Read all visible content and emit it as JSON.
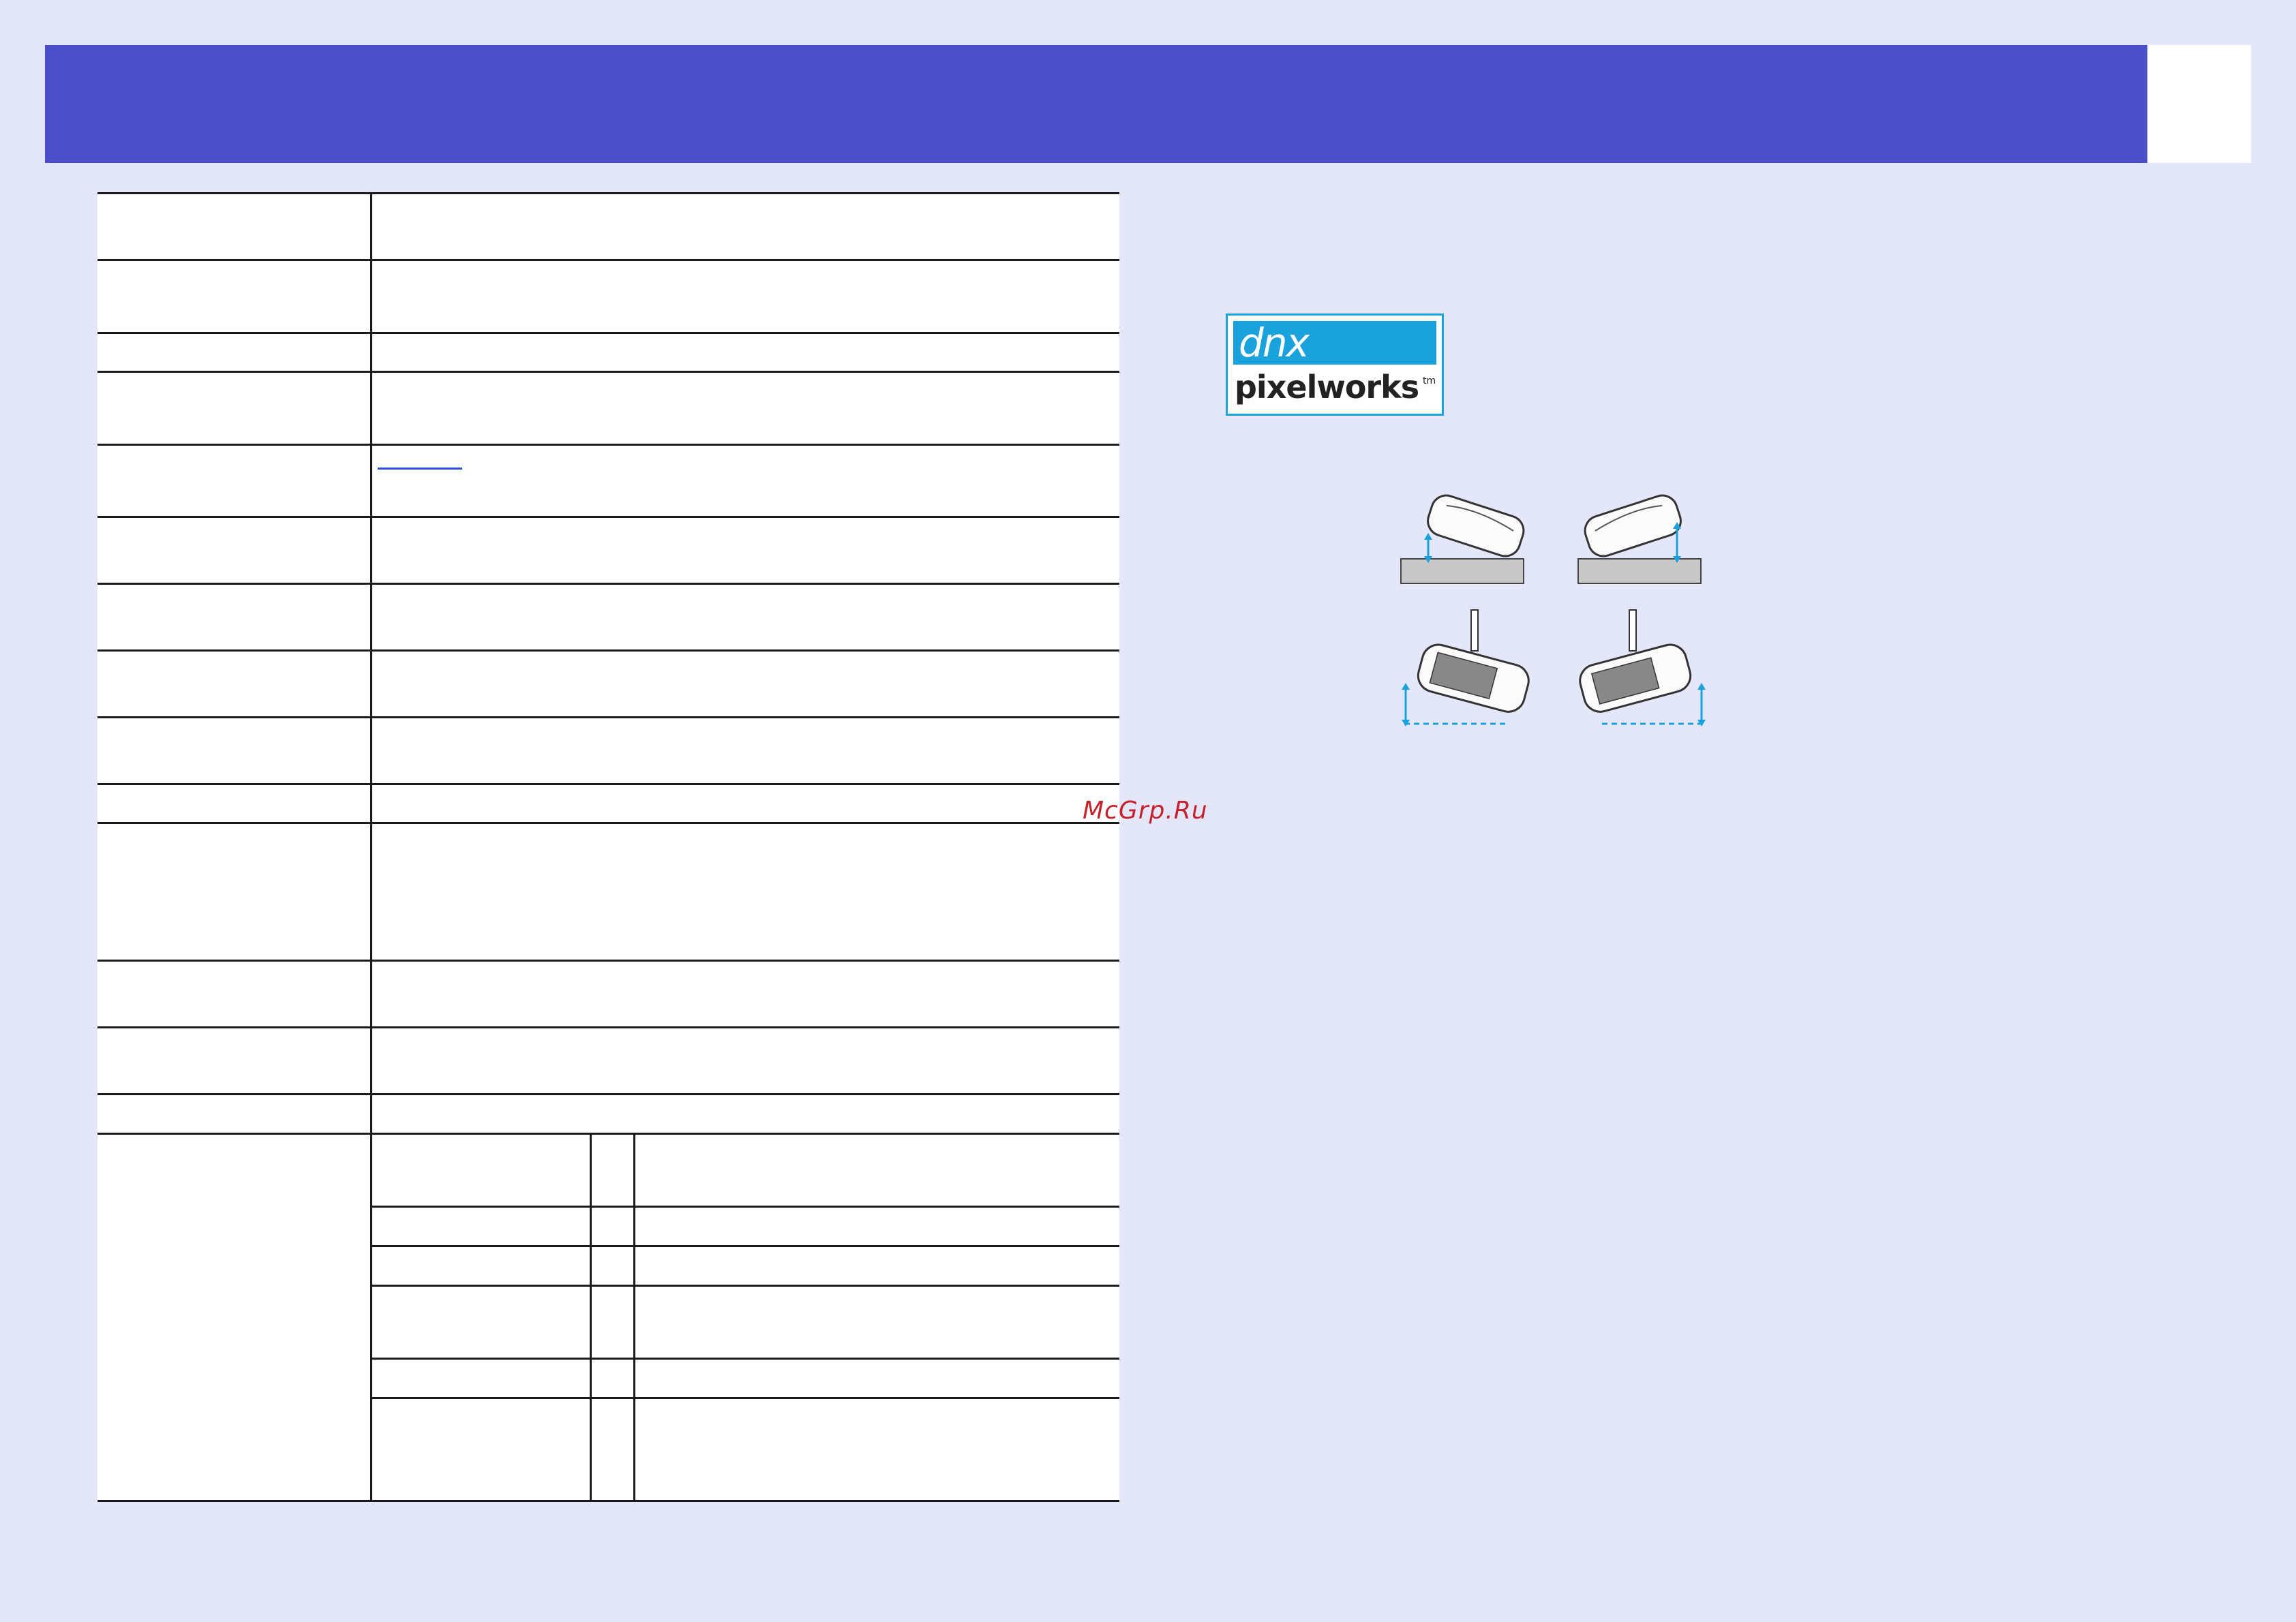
{
  "header": {
    "title": "",
    "page_number": ""
  },
  "spec_table": {
    "rows": [
      {
        "label": "",
        "value": ""
      },
      {
        "label": "",
        "value": ""
      },
      {
        "label": "",
        "value": ""
      },
      {
        "label": "",
        "value": ""
      },
      {
        "label": "",
        "value": ""
      },
      {
        "label": "",
        "value": ""
      },
      {
        "label": "",
        "value": ""
      },
      {
        "label": "",
        "value": ""
      },
      {
        "label": "",
        "value": ""
      },
      {
        "label": "",
        "value": ""
      },
      {
        "label": "",
        "value": ""
      },
      {
        "label": "",
        "value": ""
      },
      {
        "label": "",
        "value": ""
      },
      {
        "label": "",
        "value": ""
      }
    ],
    "sub_rows": [
      {
        "c1": "",
        "c2": "",
        "c3": ""
      },
      {
        "c1": "",
        "c2": "",
        "c3": ""
      },
      {
        "c1": "",
        "c2": "",
        "c3": ""
      },
      {
        "c1": "",
        "c2": "",
        "c3": ""
      },
      {
        "c1": "",
        "c2": "",
        "c3": ""
      },
      {
        "c1": "",
        "c2": "",
        "c3": ""
      }
    ],
    "link_text": ""
  },
  "logo": {
    "top_text": "dnx",
    "bottom_text": "pixelworks",
    "tm": "tm"
  },
  "watermark": "McGrp.Ru",
  "colors": {
    "background": "#e4e6fa",
    "header": "#4c4fca",
    "logo_blue": "#1aa2dd",
    "accent_arrow": "#1aa2dd",
    "watermark": "#c4232c"
  },
  "icons": [
    "projector-tilt-front-icon",
    "projector-tilt-back-icon",
    "projector-ceiling-front-icon",
    "projector-ceiling-back-icon"
  ]
}
